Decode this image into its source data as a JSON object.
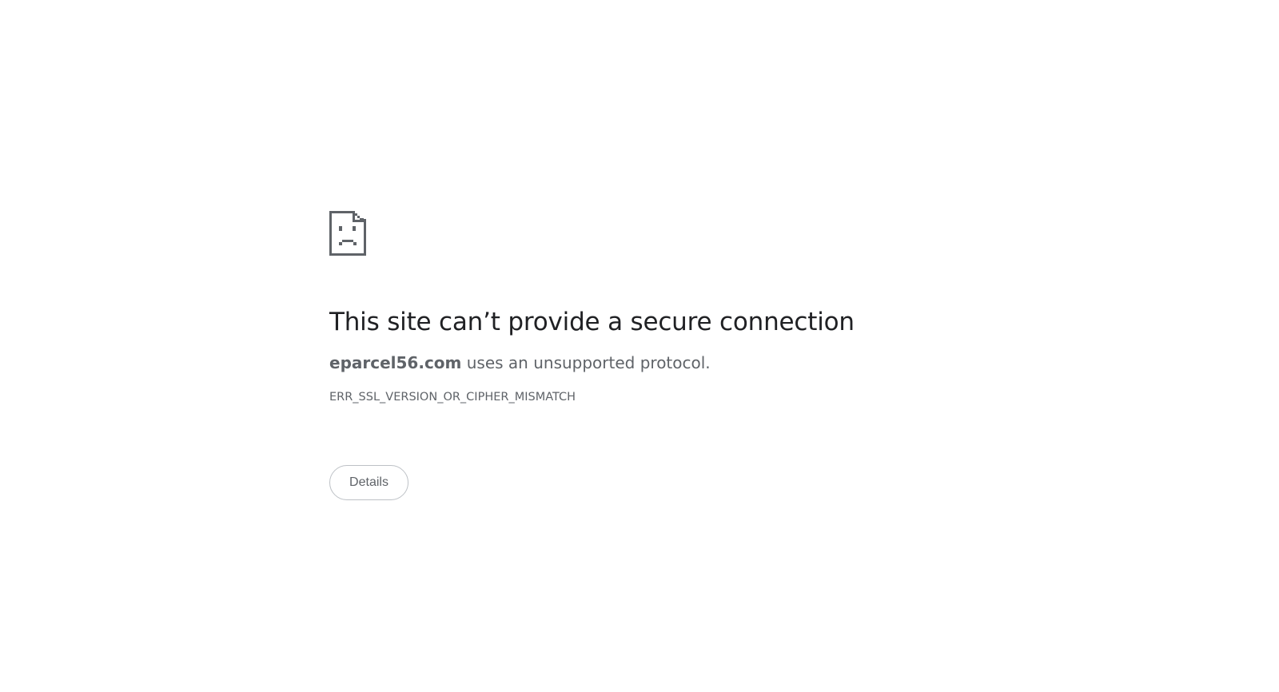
{
  "icon": "sad-page-icon",
  "title": "This site can’t provide a secure connection",
  "summary": {
    "host": "eparcel56.com",
    "message": " uses an unsupported protocol."
  },
  "error_code": "ERR_SSL_VERSION_OR_CIPHER_MISMATCH",
  "details_button_label": "Details",
  "colors": {
    "title": "#202124",
    "text": "#5f6368",
    "button_border": "#bdc1c6",
    "background": "#ffffff"
  }
}
